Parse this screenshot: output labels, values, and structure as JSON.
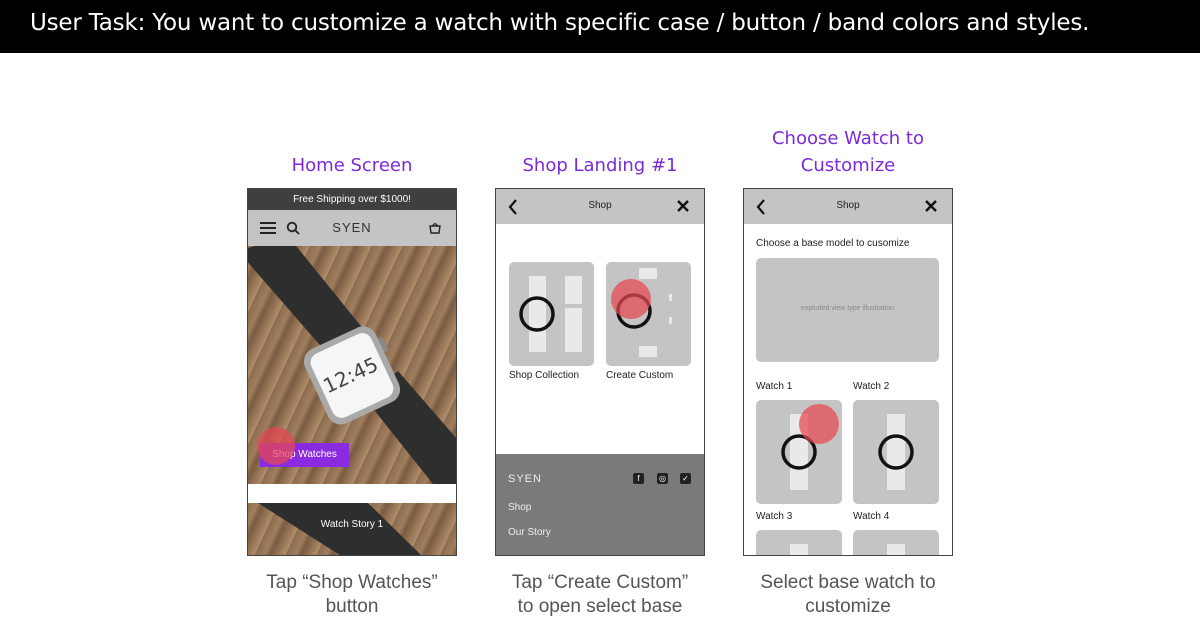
{
  "task": {
    "text": "User Task:  You want to customize a watch with specific case / button / band colors and styles."
  },
  "columns": [
    {
      "title_lines": [
        "Home Screen"
      ],
      "caption_lines": [
        "Tap “Shop Watches”",
        "button"
      ]
    },
    {
      "title_lines": [
        "Shop Landing #1"
      ],
      "caption_lines": [
        "Tap “Create Custom”",
        "to open select base"
      ]
    },
    {
      "title_lines": [
        "Choose Watch to",
        "Customize"
      ],
      "caption_lines": [
        "Select base watch to",
        "customize"
      ]
    }
  ],
  "home": {
    "promo": "Free Shipping over $1000!",
    "brand": "SYEN",
    "watch_time": "12:45",
    "shop_button": "Shop Watches",
    "story_label": "Watch Story 1",
    "accent_color": "#8a2be2",
    "icons": [
      "menu-icon",
      "search-icon",
      "bag-icon"
    ]
  },
  "shop_landing": {
    "header_title": "Shop",
    "cards": [
      "Shop Collection",
      "Create Custom"
    ],
    "footer": {
      "brand": "SYEN",
      "social_icons": [
        "facebook-icon",
        "instagram-icon",
        "twitter-icon"
      ],
      "links": [
        "Shop",
        "Our Story"
      ]
    }
  },
  "choose_watch": {
    "header_title": "Shop",
    "prompt": "Choose a base model to cusomize",
    "placeholder_text": "exploded view type illustration",
    "watches": [
      "Watch 1",
      "Watch 2",
      "Watch 3",
      "Watch 4"
    ]
  },
  "colors": {
    "title": "#7b2bd6",
    "tap_indicator": "#e64650",
    "caption": "#555555"
  }
}
